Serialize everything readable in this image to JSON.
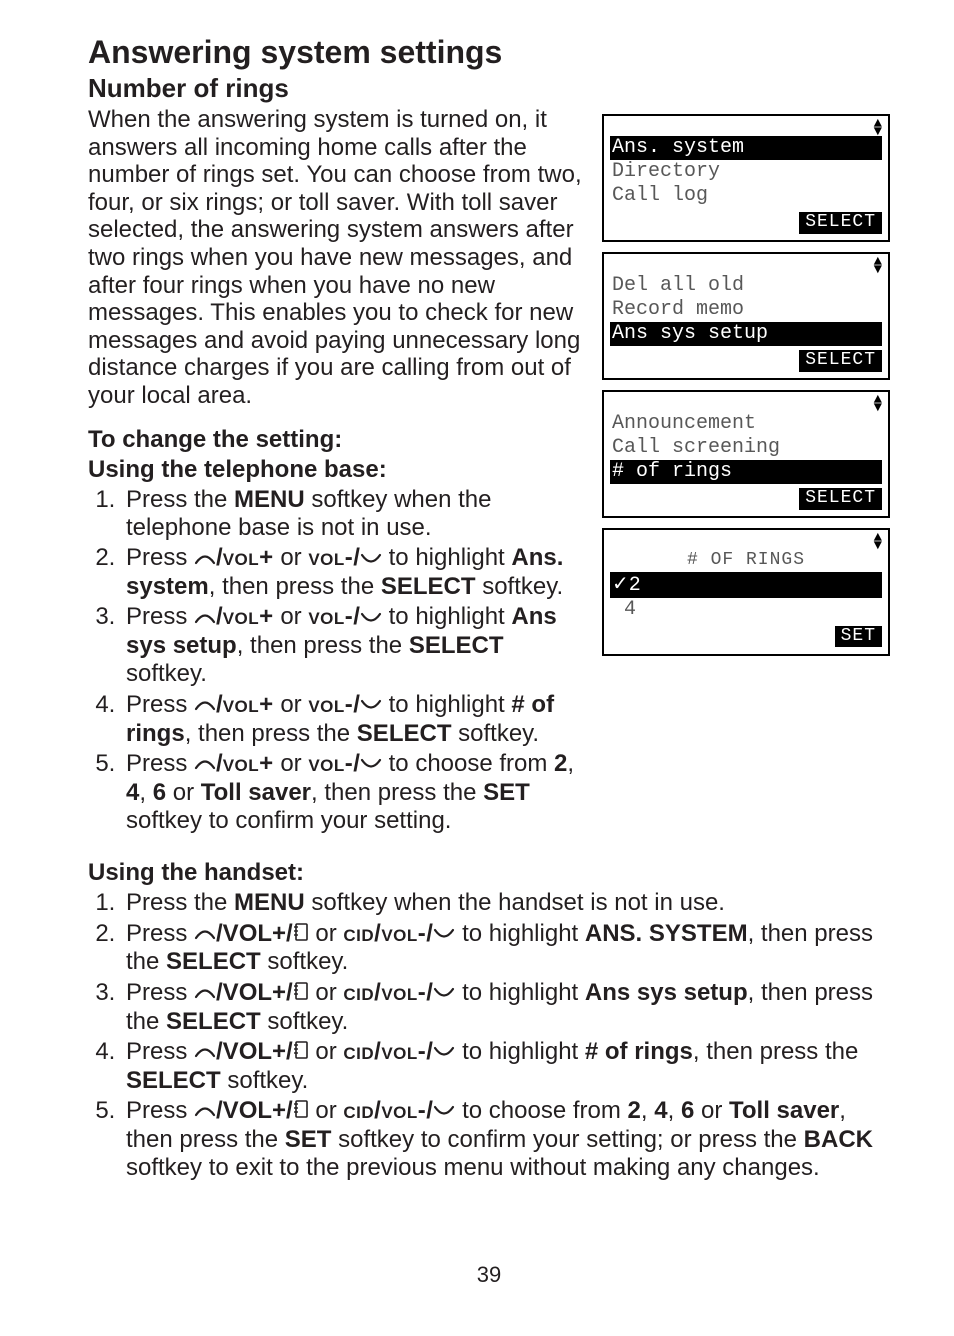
{
  "page": {
    "number": "39",
    "h1": "Answering system settings",
    "h2": "Number of rings",
    "intro": "When the answering system is turned on, it answers all incoming home calls after the number of rings set. You can choose from two, four, or six rings; or toll saver. With toll saver selected, the answering system answers after two rings when you have new messages, and after four rings when you have no new messages. This enables you to check for new messages and avoid paying unnecessary long distance charges if you are calling from out of your local area."
  },
  "sections": {
    "change": "To change the setting:",
    "base": "Using the telephone base:",
    "handset": "Using the handset:"
  },
  "keys": {
    "vol_plus_prefix": "/",
    "vol_plus": "VOL+",
    "vol_minus": "VOL-",
    "vol_minus_suffix": "/",
    "vol_plus_slash": "/VOL+/",
    "cid_vol_minus": "CID/VOL-/"
  },
  "labels": {
    "menu": "MENU",
    "select": "SELECT",
    "set": "SET",
    "back": "BACK",
    "ans_system_mixed": "Ans. system",
    "ans_sys_setup_mixed": "Ans sys setup",
    "hash_rings": "# of rings",
    "ans_system_upper": "ANS. SYSTEM",
    "toll_saver": "Toll saver",
    "n2": "2",
    "n4": "4",
    "n6": "6"
  },
  "base_steps": {
    "s1a": "Press the ",
    "s1b": " softkey when the telephone base is not in use.",
    "s2a": "Press ",
    "s2b": " or ",
    "s2c": " to highlight ",
    "s2d": ", then press the ",
    "s2e": " softkey.",
    "s3c": " to highlight ",
    "s4c": " to highlight ",
    "s4d": ", then press the ",
    "s5c": " to choose from ",
    "s5d": ", ",
    "s5e": " or ",
    "s5f": ", then press the ",
    "s5g": " softkey to confirm your setting."
  },
  "handset_steps": {
    "s1a": "Press the ",
    "s1b": " softkey when the handset is not in use.",
    "s2a": "Press ",
    "s2b": " or ",
    "s2c": " to highlight ",
    "s2d": ", then press the ",
    "s2e": " softkey.",
    "s5f": ", then press the ",
    "s5g": " softkey to confirm your setting; or press the ",
    "s5h": " softkey to exit to the previous menu without making any changes."
  },
  "lcd": {
    "select_btn": "SELECT",
    "set_btn": "SET",
    "screen1": {
      "r1": "Ans. system",
      "r2": "Directory",
      "r3": "Call log"
    },
    "screen2": {
      "r1": "Del all old",
      "r2": "Record memo",
      "r3": "Ans sys setup"
    },
    "screen3": {
      "r1": "Announcement",
      "r2": "Call screening",
      "r3": "# of rings"
    },
    "screen4": {
      "title": "# OF RINGS",
      "r1_pre": "✓",
      "r1": "2",
      "r2": " 4"
    }
  }
}
